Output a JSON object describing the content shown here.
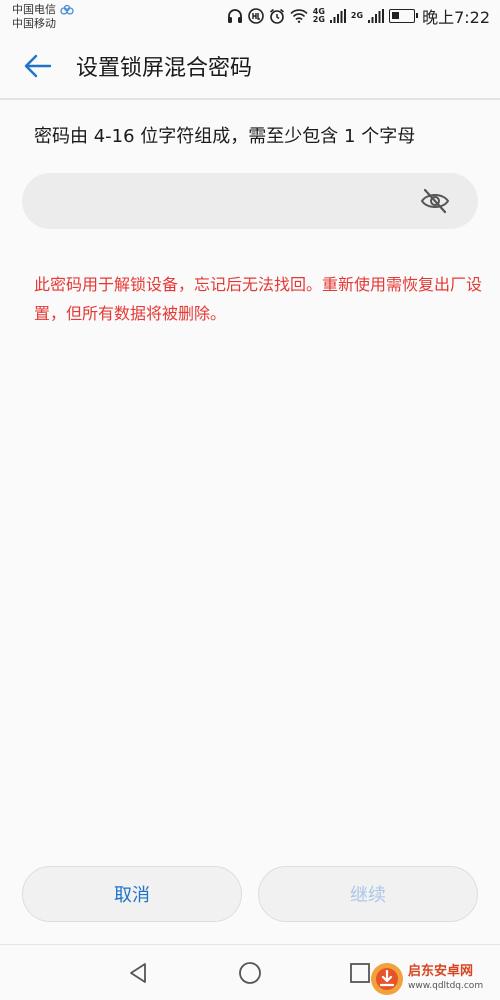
{
  "status_bar": {
    "carrier_1": "中国电信",
    "carrier_2": "中国移动",
    "net_1_top": "4G",
    "net_1_bottom": "2G",
    "net_2": "2G",
    "battery_level": 0.35,
    "time": "晚上7:22",
    "icons": [
      "headset-icon",
      "hd-call-icon",
      "alarm-icon",
      "wifi-icon",
      "signal-icon",
      "battery-icon"
    ]
  },
  "header": {
    "title": "设置锁屏混合密码",
    "back_icon": "back-arrow-icon"
  },
  "form": {
    "instruction": "密码由 4-16 位字符组成，需至少包含 1 个字母",
    "password_value": "",
    "visibility_icon": "eye-off-icon",
    "warning": "此密码用于解锁设备，忘记后无法找回。重新使用需恢复出厂设置，但所有数据将被删除。"
  },
  "buttons": {
    "cancel_label": "取消",
    "continue_label": "继续"
  },
  "nav": {
    "icons": [
      "nav-back-icon",
      "nav-home-icon",
      "nav-recent-icon"
    ]
  },
  "watermark": {
    "name": "启东安卓网",
    "url": "www.qdltdq.com"
  },
  "colors": {
    "accent": "#1e73c8",
    "warning": "#e53935",
    "disabled": "#aac6e6"
  }
}
